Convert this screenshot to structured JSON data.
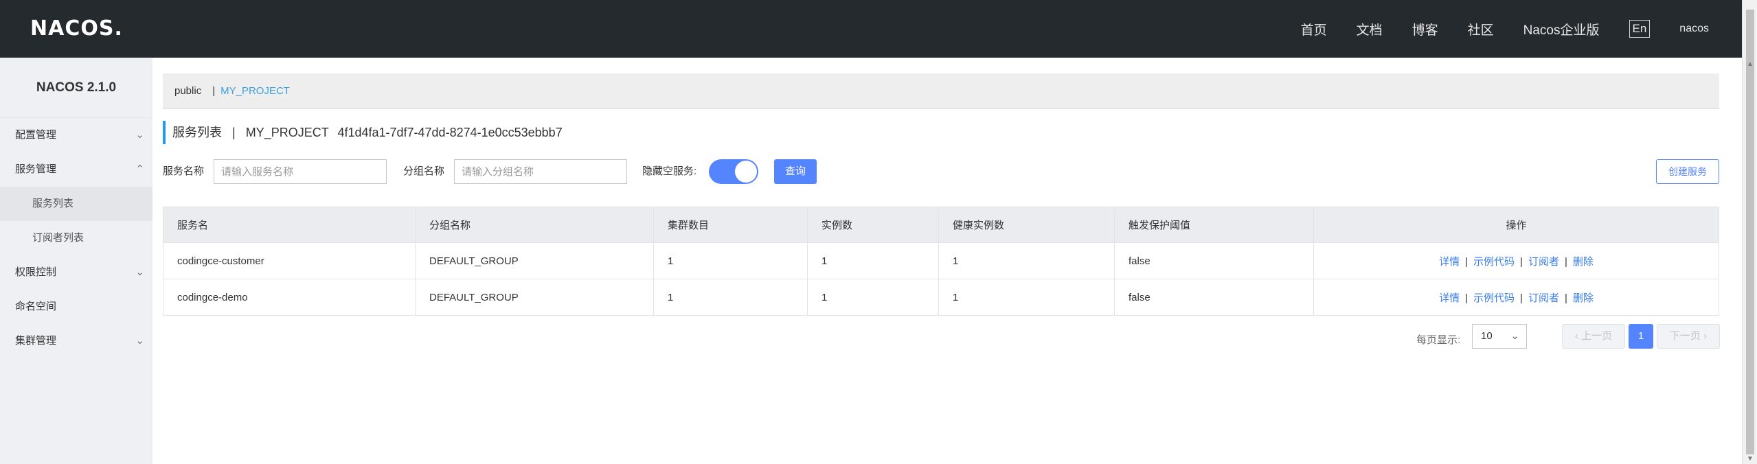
{
  "header": {
    "logo": "NACOS.",
    "nav": [
      "首页",
      "文档",
      "博客",
      "社区",
      "Nacos企业版"
    ],
    "lang": "En",
    "user": "nacos"
  },
  "sidebar": {
    "version": "NACOS 2.1.0",
    "items": [
      {
        "label": "配置管理",
        "chevron": "chevron-down-icon"
      },
      {
        "label": "服务管理",
        "chevron": "chevron-up-icon"
      },
      {
        "label": "服务列表",
        "sub": true,
        "active": true
      },
      {
        "label": "订阅者列表",
        "sub": true
      },
      {
        "label": "权限控制",
        "chevron": "chevron-down-icon"
      },
      {
        "label": "命名空间"
      },
      {
        "label": "集群管理",
        "chevron": "chevron-down-icon"
      }
    ]
  },
  "namespace": {
    "public": "public",
    "separator": "|",
    "active": "MY_PROJECT"
  },
  "title": {
    "main": "服务列表",
    "divider": "|",
    "namespace_name": "MY_PROJECT",
    "namespace_id": "4f1d4fa1-7df7-47dd-8274-1e0cc53ebbb7"
  },
  "filters": {
    "service_name_label": "服务名称",
    "service_name_placeholder": "请输入服务名称",
    "group_name_label": "分组名称",
    "group_name_placeholder": "请输入分组名称",
    "hide_empty_label": "隐藏空服务:",
    "hide_empty_on": true,
    "query_label": "查询",
    "create_label": "创建服务"
  },
  "table": {
    "columns": [
      "服务名",
      "分组名称",
      "集群数目",
      "实例数",
      "健康实例数",
      "触发保护阈值",
      "操作"
    ],
    "rows": [
      [
        "codingce-customer",
        "DEFAULT_GROUP",
        "1",
        "1",
        "1",
        "false"
      ],
      [
        "codingce-demo",
        "DEFAULT_GROUP",
        "1",
        "1",
        "1",
        "false"
      ]
    ],
    "actions": [
      "详情",
      "示例代码",
      "订阅者",
      "删除"
    ],
    "action_separator": "|"
  },
  "pagination": {
    "per_page_label": "每页显示:",
    "page_size": "10",
    "prev_label": "上一页",
    "next_label": "下一页",
    "current_page": "1"
  },
  "colors": {
    "topbar_bg": "#252a2f",
    "accent": "#5584ff",
    "link": "#3a7ee8",
    "ns_active": "#3ca1de",
    "sidebar_bg": "#eef0f3"
  }
}
